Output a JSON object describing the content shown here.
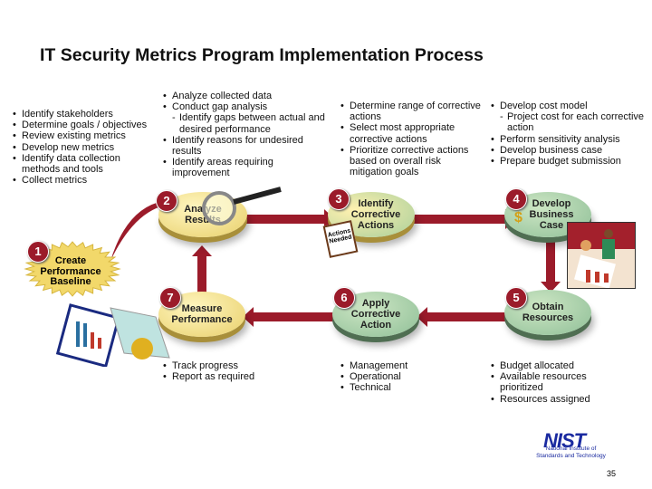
{
  "title": "IT Security Metrics Program Implementation Process",
  "steps": [
    {
      "n": "1",
      "label": "Create Performance Baseline"
    },
    {
      "n": "2",
      "label": "Analyze Results"
    },
    {
      "n": "3",
      "label": "Identify Corrective Actions"
    },
    {
      "n": "4",
      "label": "Develop Business Case"
    },
    {
      "n": "5",
      "label": "Obtain Resources"
    },
    {
      "n": "6",
      "label": "Apply Corrective Action"
    },
    {
      "n": "7",
      "label": "Measure Performance"
    }
  ],
  "notes": {
    "step1": [
      "Identify stakeholders",
      "Determine goals / objectives",
      "Review existing metrics",
      "Develop new metrics",
      "Identify data collection methods and tools",
      "Collect metrics"
    ],
    "step2": [
      "Analyze collected data",
      "Conduct gap analysis",
      "Identify gaps between actual and desired performance",
      "Identify reasons for undesired results",
      "Identify areas requiring improvement"
    ],
    "step3": [
      "Determine range of corrective actions",
      "Select most appropriate corrective actions",
      "Prioritize corrective actions based on overall risk mitigation goals"
    ],
    "step4": [
      "Develop cost model",
      "Project cost for each corrective action",
      "Perform sensitivity analysis",
      "Develop business case",
      "Prepare budget submission"
    ],
    "step7": [
      "Track progress",
      "Report as required"
    ],
    "step6": [
      "Management",
      "Operational",
      "Technical"
    ],
    "step5": [
      "Budget allocated",
      "Available resources prioritized",
      "Resources assigned"
    ]
  },
  "clipboard_text": "Actions Needed",
  "logo": {
    "name": "NIST",
    "subtitle": "National Institute of Standards and Technology"
  },
  "page_number": "35",
  "colors": {
    "arrow": "#9b1b2a",
    "green": "#8fbf97",
    "yellow": "#e8cf6a",
    "nist_blue": "#1a2aa0"
  }
}
